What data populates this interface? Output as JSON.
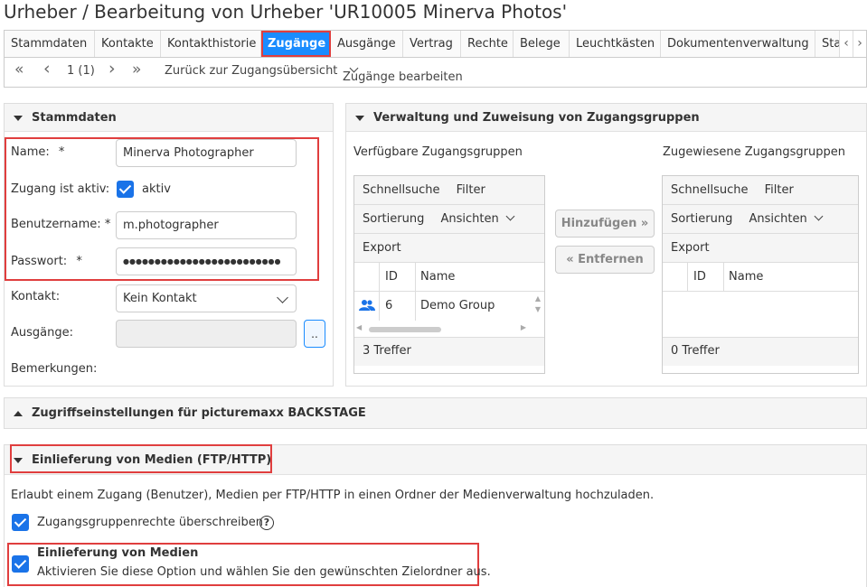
{
  "page_title": "Urheber / Bearbeitung von Urheber 'UR10005 Minerva Photos'",
  "tabs": [
    {
      "label": "Stammdaten"
    },
    {
      "label": "Kontakte"
    },
    {
      "label": "Kontakthistorie"
    },
    {
      "label": "Zugänge",
      "active": true
    },
    {
      "label": "Ausgänge"
    },
    {
      "label": "Vertrag"
    },
    {
      "label": "Rechte"
    },
    {
      "label": "Belege"
    },
    {
      "label": "Leuchtkästen"
    },
    {
      "label": "Dokumentenverwaltung"
    },
    {
      "label": "Sta"
    }
  ],
  "pager": {
    "first": "«",
    "prev": "‹",
    "position": "1 (1)",
    "next": "›",
    "last": "»",
    "back_link": "Zurück zur Zugangsübersicht",
    "edit_menu": "Zugänge bearbeiten"
  },
  "stammdaten": {
    "header": "Stammdaten",
    "name_label": "Name:",
    "name_value": "Minerva Photographer",
    "active_label": "Zugang ist aktiv:",
    "active_text": "aktiv",
    "active_checked": true,
    "username_label": "Benutzername:",
    "username_value": "m.photographer",
    "password_label": "Passwort:",
    "password_value": "●●●●●●●●●●●●●●●●●●●●●●●●●",
    "required_mark": "*",
    "contact_label": "Kontakt:",
    "contact_value": "Kein Kontakt",
    "outputs_label": "Ausgänge:",
    "outputs_button": "..",
    "notes_label": "Bemerkungen:"
  },
  "groups": {
    "header": "Verwaltung und Zuweisung von Zugangsgruppen",
    "available_title": "Verfügbare Zugangsgruppen",
    "assigned_title": "Zugewiesene Zugangsgruppen",
    "quick_search": "Schnellsuche",
    "filter": "Filter",
    "sort": "Sortierung",
    "views": "Ansichten",
    "export": "Export",
    "col_id": "ID",
    "col_name": "Name",
    "available_rows": [
      {
        "id": "6",
        "name": "Demo Group"
      }
    ],
    "available_count": "3 Treffer",
    "assigned_count": "0 Treffer",
    "add_button": "Hinzufügen »",
    "remove_button": "« Entfernen"
  },
  "access_section": {
    "header": "Zugriffseinstellungen für picturemaxx BACKSTAGE"
  },
  "delivery_section": {
    "header": "Einlieferung von Medien (FTP/HTTP)",
    "description": "Erlaubt einem Zugang (Benutzer), Medien per FTP/HTTP in einen Ordner der Medienverwaltung hochzuladen.",
    "override_label": "Zugangsgruppenrechte überschreiben",
    "help": "?",
    "media_title": "Einlieferung von Medien",
    "media_desc": "Aktivieren Sie diese Option und wählen Sie den gewünschten Zielordner aus."
  },
  "colors": {
    "accent": "#1a8cff",
    "highlight": "#e03e3e",
    "checkbox": "#1a73e8"
  }
}
